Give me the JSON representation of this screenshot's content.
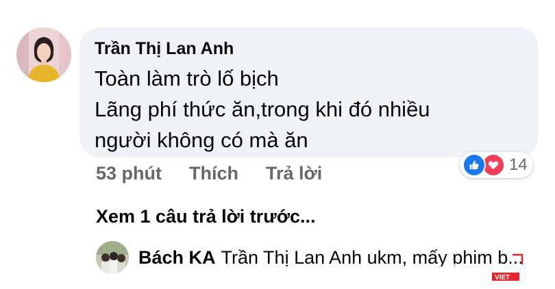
{
  "comment": {
    "author": "Trần Thị Lan Anh",
    "lines": [
      "Toàn làm trò lố bịch",
      "Lãng phí thức ăn,trong khi đó nhiều",
      "người không có mà ăn"
    ],
    "timestamp": "53 phút",
    "like_label": "Thích",
    "reply_label": "Trả lời",
    "reaction_count": "14",
    "reaction_icons": [
      "like-icon",
      "love-icon"
    ]
  },
  "replies": {
    "more_label": "Xem 1 câu trả lời trước...",
    "latest": {
      "author": "Bách KA",
      "text": "Trần Thị Lan Anh ukm, mấy phim b..."
    }
  },
  "watermark": {
    "text": "VIET",
    "small_text": "VIET"
  },
  "colors": {
    "bubble": "#f0f2f5",
    "secondary_text": "#65676b",
    "like_blue": "#1877f2",
    "love_red": "#f33e58"
  }
}
